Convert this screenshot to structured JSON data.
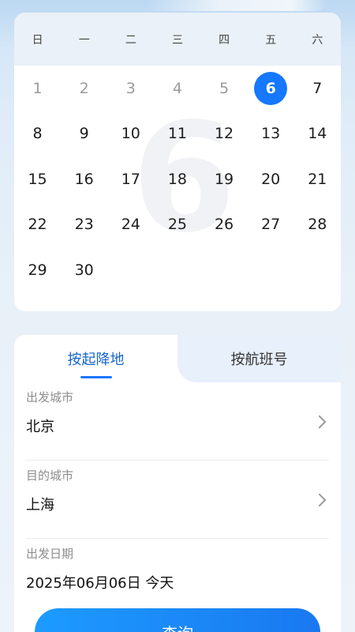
{
  "calendar": {
    "weekdays": [
      "日",
      "一",
      "二",
      "三",
      "四",
      "五",
      "六"
    ],
    "watermark": "6",
    "selected_day": "6",
    "weeks": [
      [
        "1",
        "2",
        "3",
        "4",
        "5",
        "6",
        "7"
      ],
      [
        "8",
        "9",
        "10",
        "11",
        "12",
        "13",
        "14"
      ],
      [
        "15",
        "16",
        "17",
        "18",
        "19",
        "20",
        "21"
      ],
      [
        "22",
        "23",
        "24",
        "25",
        "26",
        "27",
        "28"
      ],
      [
        "29",
        "30",
        "",
        "",
        "",
        "",
        ""
      ]
    ]
  },
  "tabs": {
    "by_airport": "按起降地",
    "by_flight": "按航班号"
  },
  "form": {
    "departure_label": "出发城市",
    "departure_value": "北京",
    "destination_label": "目的城市",
    "destination_value": "上海",
    "date_label": "出发日期",
    "date_value": "2025年06月06日 今天"
  },
  "query_button": "查询",
  "colors": {
    "accent": "#1677ff",
    "tab_active_text": "#1566c9",
    "header_bg": "#eaf1f8"
  },
  "icons": [
    "chevron-right-icon"
  ]
}
